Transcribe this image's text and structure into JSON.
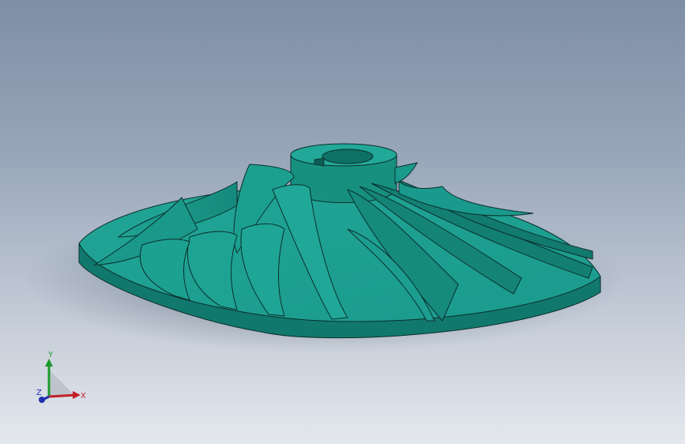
{
  "viewport": {
    "background_top": "#7e8ea6",
    "background_bottom": "#e4e8ee"
  },
  "model": {
    "body_color": "#1a9a8c",
    "edge_color": "#0b2f2c",
    "shadow_color": "#0e5e56",
    "blade_count": 14
  },
  "triad": {
    "x_label": "X",
    "y_label": "Y",
    "z_label": "Z",
    "x_color": "#c0202a",
    "y_color": "#1c9a2c",
    "z_color": "#2030b0"
  }
}
